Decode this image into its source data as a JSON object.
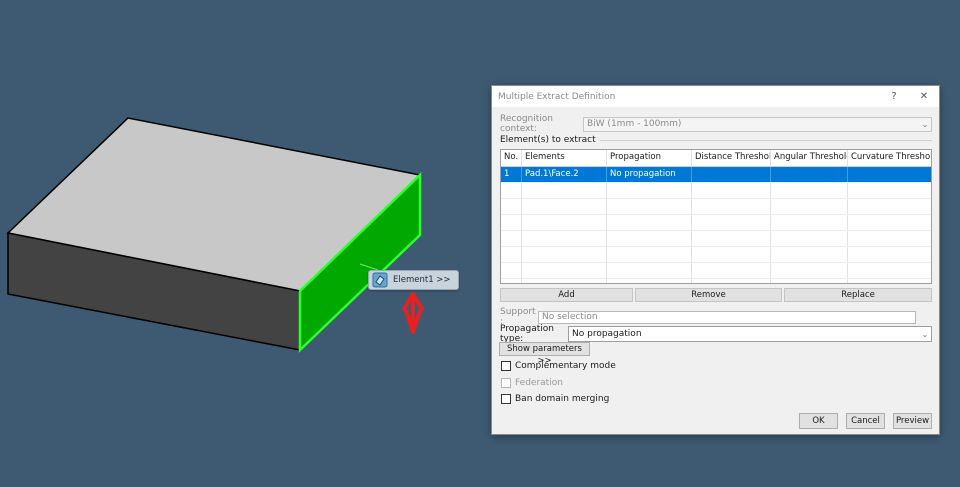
{
  "viewport": {
    "tag_label": "Element1 >>",
    "tag_icon": "extract-surface-icon",
    "colors": {
      "background": "#3e5a72",
      "selection_face": "#00a800",
      "selection_edge": "#2bff2b",
      "arrow": "#e82020"
    }
  },
  "dialog": {
    "title": "Multiple Extract Definition",
    "help_label": "?",
    "close_label": "✕",
    "recognition_context": {
      "label": "Recognition context:",
      "value": "BiW (1mm - 100mm)"
    },
    "elements_group_label": "Element(s) to extract",
    "table": {
      "headers": [
        "No.",
        "Elements",
        "Propagation",
        "Distance Threshold",
        "Angular Threshold",
        "Curvature Threshold"
      ],
      "rows": [
        [
          "1",
          "Pad.1\\Face.2",
          "No propagation",
          "",
          "",
          ""
        ]
      ]
    },
    "buttons": {
      "add": "Add",
      "remove": "Remove",
      "replace": "Replace"
    },
    "support": {
      "label": "Support :",
      "value": "No selection"
    },
    "propagation_type": {
      "label": "Propagation type:",
      "value": "No propagation"
    },
    "show_parameters": "Show parameters >>",
    "checkboxes": {
      "complementary": "Complementary mode",
      "federation": "Federation",
      "ban_domain": "Ban domain merging"
    },
    "footer": {
      "ok": "OK",
      "cancel": "Cancel",
      "preview": "Preview"
    }
  }
}
